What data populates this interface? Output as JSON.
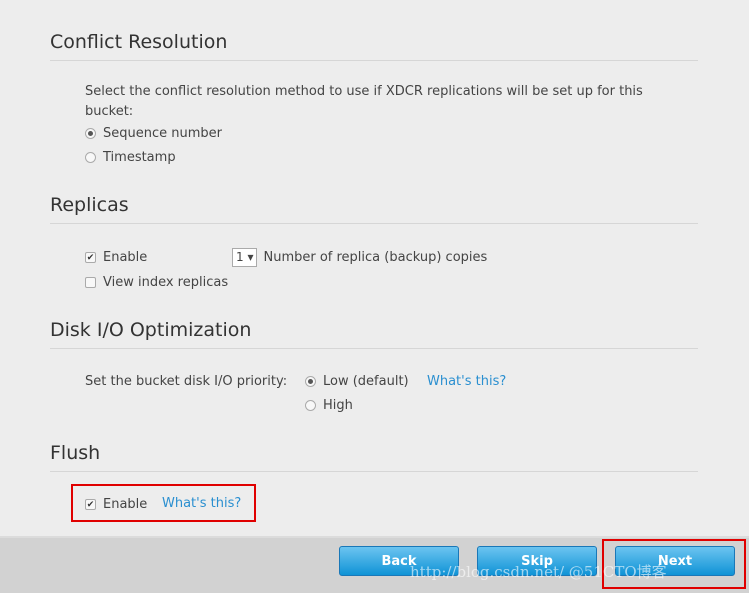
{
  "conflict": {
    "title": "Conflict Resolution",
    "description": "Select the conflict resolution method to use if XDCR replications will be set up for this bucket:",
    "options": [
      {
        "label": "Sequence number",
        "selected": true
      },
      {
        "label": "Timestamp",
        "selected": false
      }
    ]
  },
  "replicas": {
    "title": "Replicas",
    "enable_label": "Enable",
    "enable_checked": true,
    "count": "1 ▾",
    "count_label": "Number of replica (backup) copies",
    "view_index_label": "View index replicas",
    "view_index_checked": false
  },
  "disk": {
    "title": "Disk I/O Optimization",
    "label": "Set the bucket disk I/O priority:",
    "options": [
      {
        "label": "Low (default)",
        "selected": true
      },
      {
        "label": "High",
        "selected": false
      }
    ],
    "help": "What's this?"
  },
  "flush": {
    "title": "Flush",
    "enable_label": "Enable",
    "enable_checked": true,
    "help": "What's this?"
  },
  "footer": {
    "back": "Back",
    "skip": "Skip",
    "next": "Next"
  },
  "watermark": "http://blog.csdn.net/  @51CTO博客",
  "colors": {
    "accent": "#2a8fd0",
    "button": "#0f93d6",
    "highlight": "#e00000"
  }
}
